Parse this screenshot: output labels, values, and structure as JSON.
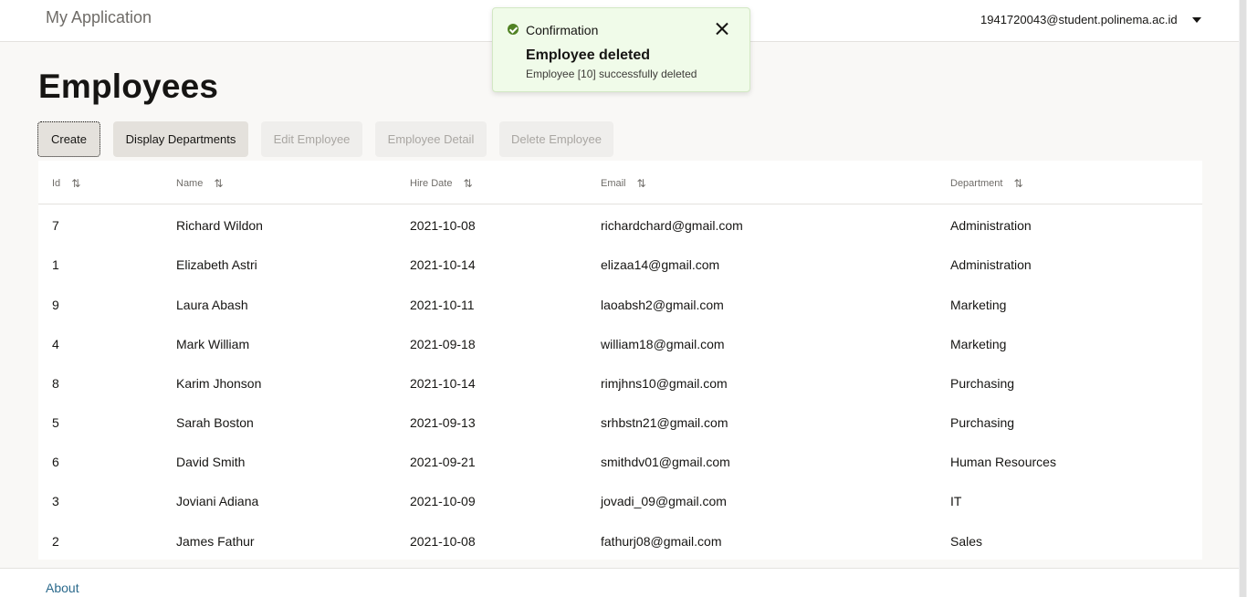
{
  "header": {
    "app_title": "My Application",
    "user_email": "1941720043@student.polinema.ac.id"
  },
  "page": {
    "title": "Employees"
  },
  "toolbar": {
    "create_label": "Create",
    "display_departments_label": "Display Departments",
    "edit_label": "Edit Employee",
    "detail_label": "Employee Detail",
    "delete_label": "Delete Employee"
  },
  "table": {
    "columns": [
      "Id",
      "Name",
      "Hire Date",
      "Email",
      "Department"
    ],
    "sort_icon": "⇅",
    "rows": [
      [
        "7",
        "Richard Wildon",
        "2021-10-08",
        "richardchard@gmail.com",
        "Administration"
      ],
      [
        "1",
        "Elizabeth Astri",
        "2021-10-14",
        "elizaa14@gmail.com",
        "Administration"
      ],
      [
        "9",
        "Laura Abash",
        "2021-10-11",
        "laoabsh2@gmail.com",
        "Marketing"
      ],
      [
        "4",
        "Mark William",
        "2021-09-18",
        "william18@gmail.com",
        "Marketing"
      ],
      [
        "8",
        "Karim Jhonson",
        "2021-10-14",
        "rimjhns10@gmail.com",
        "Purchasing"
      ],
      [
        "5",
        "Sarah Boston",
        "2021-09-13",
        "srhbstn21@gmail.com",
        "Purchasing"
      ],
      [
        "6",
        "David Smith",
        "2021-09-21",
        "smithdv01@gmail.com",
        "Human Resources"
      ],
      [
        "3",
        "Joviani Adiana",
        "2021-10-09",
        "jovadi_09@gmail.com",
        "IT"
      ],
      [
        "2",
        "James Fathur",
        "2021-10-08",
        "fathurj08@gmail.com",
        "Sales"
      ]
    ]
  },
  "toast": {
    "heading": "Confirmation",
    "summary": "Employee deleted",
    "detail": "Employee [10] successfully deleted",
    "icon": "check-circle-icon",
    "success_color": "#508223"
  },
  "footer": {
    "about_label": "About"
  }
}
